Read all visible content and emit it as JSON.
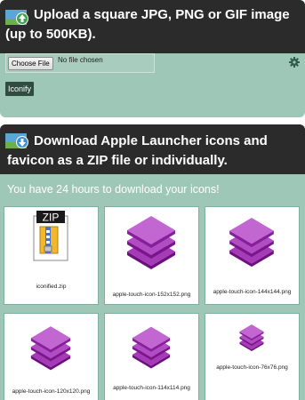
{
  "upload": {
    "title": "Upload a square JPG, PNG or GIF image (up to 500KB).",
    "choose_button": "Choose File",
    "no_file_text": "No file chosen",
    "submit_label": "Iconify"
  },
  "download": {
    "title_line1": "Download Apple Launcher icons and",
    "title_line2": "favicon as a ZIP file or individually.",
    "note": "You have 24 hours to download your icons!",
    "zip_badge": "ZIP",
    "files": [
      "iconified.zip",
      "apple-touch-icon-152x152.png",
      "apple-touch-icon-144x144.png",
      "apple-touch-icon-120x120.png",
      "apple-touch-icon-114x114.png",
      "apple-touch-icon-76x76.png"
    ]
  },
  "colors": {
    "panel_bg": "#9fc7b8",
    "header_bg": "#2b2b2b",
    "accent_purple": "#8b1a9e",
    "button_dark": "#2e4c41"
  },
  "icons": [
    "upload-icon",
    "download-icon",
    "gear-icon",
    "zip-icon",
    "stack-icon"
  ]
}
